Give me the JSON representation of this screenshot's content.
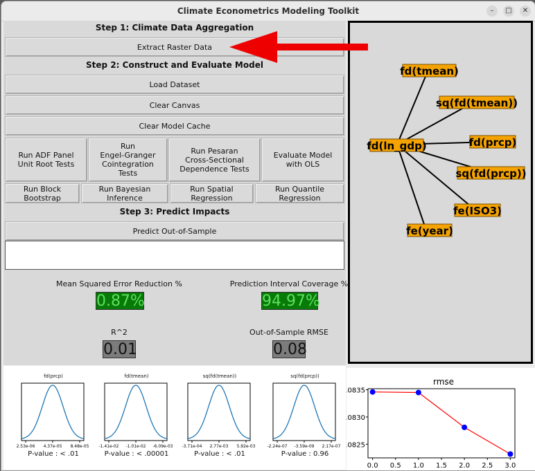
{
  "window": {
    "title": "Climate Econometrics Modeling Toolkit"
  },
  "step1": {
    "heading": "Step 1: Climate Data Aggregation",
    "extract_label": "Extract Raster Data"
  },
  "step2": {
    "heading": "Step 2: Construct and Evaluate Model",
    "load_label": "Load Dataset",
    "clear_canvas_label": "Clear Canvas",
    "clear_cache_label": "Clear Model Cache",
    "adf_label": "Run ADF Panel\nUnit Root Tests",
    "engle_label": "Run\nEngel-Granger\nCointegration\nTests",
    "pesaran_label": "Run Pesaran\nCross-Sectional\nDependence Tests",
    "ols_label": "Evaluate Model\nwith OLS",
    "bootstrap_label": "Run Block Bootstrap",
    "bayes_label": "Run Bayesian Inference",
    "spatial_label": "Run Spatial Regression",
    "quantile_label": "Run Quantile Regression"
  },
  "step3": {
    "heading": "Step 3: Predict Impacts",
    "predict_label": "Predict Out-of-Sample"
  },
  "metrics": {
    "mse_label": "Mean Squared Error Reduction %",
    "mse_value": "0.87%",
    "pic_label": "Prediction Interval Coverage %",
    "pic_value": "94.97%",
    "r2_label": "R^2",
    "r2_value": "0.01",
    "rmse_label": "Out-of-Sample RMSE",
    "rmse_value": "0.08"
  },
  "graph": {
    "center": "fd(ln_gdp)",
    "nodes": [
      "fd(tmean)",
      "sq(fd(tmean))",
      "fd(prcp)",
      "sq(fd(prcp))",
      "fe(ISO3)",
      "fe(year)"
    ]
  },
  "distributions": [
    {
      "title": "fd(prcp)",
      "ticks": [
        "2.53e-06",
        "4.37e-05",
        "8.48e-05"
      ],
      "pvalue": "P-value : < .01"
    },
    {
      "title": "fd(tmean)",
      "ticks": [
        "-1.41e-02",
        "-1.01e-02",
        "-6.09e-03"
      ],
      "pvalue": "P-value : < .00001"
    },
    {
      "title": "sq(fd(tmean))",
      "ticks": [
        "-3.71e-04",
        "2.77e-03",
        "5.92e-03"
      ],
      "pvalue": "P-value : < .01"
    },
    {
      "title": "sq(fd(prcp))",
      "ticks": [
        "-2.24e-07",
        "-3.59e-09",
        "2.17e-07"
      ],
      "pvalue": "P-value : 0.96"
    }
  ],
  "colors": {
    "node_fill": "#f5a300",
    "metric_green": "#077a07",
    "arrow_red": "#ee0000",
    "line_series": "#ff0000",
    "point_fill": "#0000ff",
    "curve": "#1f77b4"
  },
  "chart_data": {
    "type": "line",
    "title": "rmse",
    "x": [
      0.0,
      1.0,
      2.0,
      3.0
    ],
    "values": [
      0.08346,
      0.08345,
      0.08281,
      0.08232
    ],
    "xticks": [
      "0.0",
      "0.5",
      "1.0",
      "1.5",
      "2.0",
      "2.5",
      "3.0"
    ],
    "yticks": [
      ".0835",
      ".0830",
      ".0825"
    ],
    "xlim": [
      -0.1,
      3.1
    ],
    "ylim": [
      0.08225,
      0.08352
    ]
  }
}
